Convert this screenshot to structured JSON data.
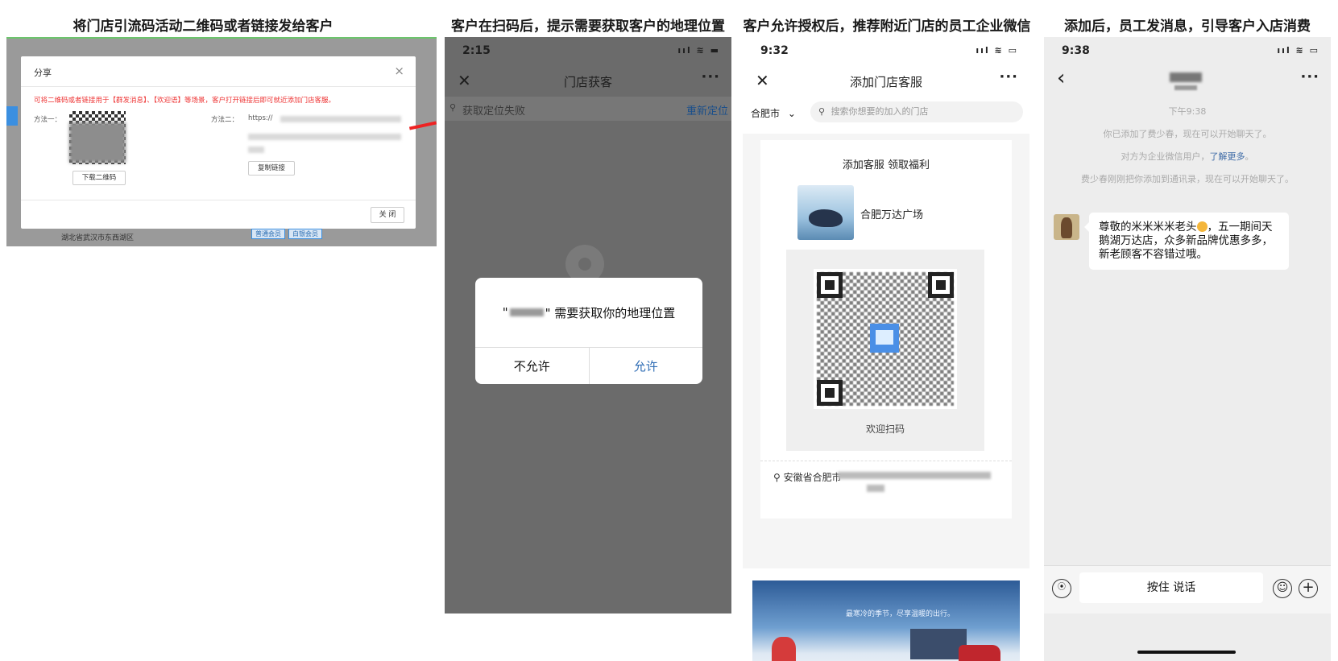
{
  "steps": [
    "将门店引流码活动二维码或者链接发给客户",
    "客户在扫码后，提示需要获取客户的地理位置",
    "客户允许授权后，推荐附近门店的员工企业微信",
    "添加后，员工发消息，引导客户入店消费"
  ],
  "share_dialog": {
    "title": "分享",
    "close_glyph": "×",
    "tip": "可将二维码或者链接用于【群发消息】、【欢迎语】等场景，客户打开链接后即可就近添加门店客服。",
    "method1_label": "方法一：",
    "download_button": "下载二维码",
    "method2_label": "方法二：",
    "url_prefix": "https://",
    "copy_button": "复制链接",
    "close_button": "关 闭",
    "bg_address": "湖北省武汉市东西湖区",
    "bg_tags": [
      "普通会员",
      "白银会员"
    ]
  },
  "panel2": {
    "time": "2:15",
    "signal": "ııl ≋ ▬",
    "nav_left": "✕",
    "title": "门店获客",
    "nav_right": "···",
    "location_icon": "⚲",
    "location_status": "获取定位失败",
    "relocate": "重新定位",
    "alert_prefix": "\"",
    "alert_suffix": "\" 需要获取你的地理位置",
    "deny": "不允许",
    "allow": "允许"
  },
  "panel3": {
    "time": "9:32",
    "signal": "ııl ≋ ▭",
    "nav_left": "✕",
    "title": "添加门店客服",
    "nav_right": "···",
    "city": "合肥市",
    "city_chevron": "⌄",
    "search_icon": "⚲",
    "search_placeholder": "搜索你想要的加入的门店",
    "card_title": "添加客服 领取福利",
    "store_name": "合肥万达广场",
    "qr_caption": "欢迎扫码",
    "address_icon": "⚲",
    "address_prefix": "安徽省合肥市",
    "banner_text": "最寒冷的季节，尽享温暖的出行。"
  },
  "panel4": {
    "time": "9:38",
    "signal": "ııl ≋ ▭",
    "nav_left": "‹",
    "nav_right": "···",
    "system_time": "下午9:38",
    "system_msg1": "你已添加了费少春，现在可以开始聊天了。",
    "system_msg2_prefix": "对方为企业微信用户，",
    "system_msg2_link": "了解更多",
    "system_msg2_suffix": "。",
    "system_msg3": "费少春刚刚把你添加到通讯录，现在可以开始聊天了。",
    "bubble_part1": "尊敬的米米米米老头",
    "bubble_part2": "，五一期间天鹅湖万达店，众多新品牌优惠多多，新老顾客不容错过哦。",
    "voice_glyph": "⦿",
    "hold_to_talk": "按住 说话",
    "emoji_glyph": "☺",
    "plus_glyph": "+"
  }
}
